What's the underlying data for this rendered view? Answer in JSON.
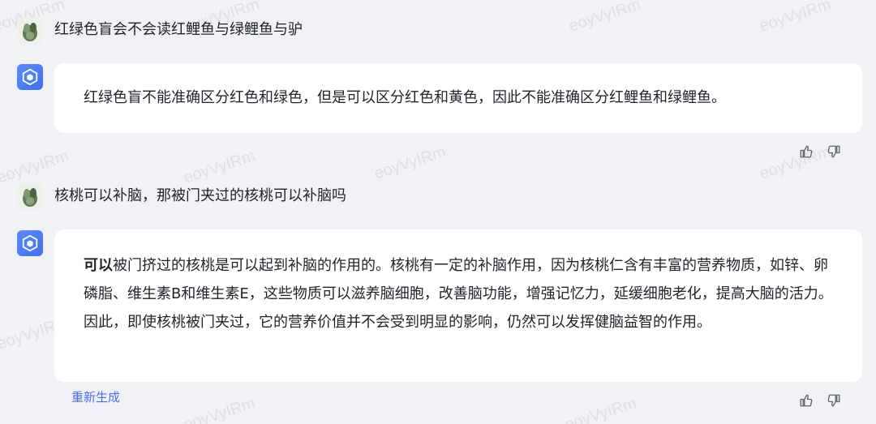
{
  "conversation": {
    "q1": "红绿色盲会不会读红鲤鱼与绿鲤鱼与驴",
    "a1": "红绿色盲不能准确区分红色和绿色，但是可以区分红色和黄色，因此不能准确区分红鲤鱼和绿鲤鱼。",
    "q2": "核桃可以补脑，那被门夹过的核桃可以补脑吗",
    "a2_bold": "可以",
    "a2_rest": "被门挤过的核桃是可以起到补脑的作用的。核桃有一定的补脑作用，因为核桃仁含有丰富的营养物质，如锌、卵磷脂、维生素B和维生素E，这些物质可以滋养脑细胞，改善脑功能，增强记忆力，延缓细胞老化，提高大脑的活力。因此，即使核桃被门夹过，它的营养价值并不会受到明显的影响，仍然可以发挥健脑益智的作用。"
  },
  "actions": {
    "regenerate_label": "重新生成",
    "like_icon": "thumbs-up-icon",
    "dislike_icon": "thumbs-down-icon"
  },
  "watermark": "eoyVyIRm",
  "colors": {
    "background": "#f1f2f6",
    "bubble": "#ffffff",
    "accent": "#4e6ef2"
  }
}
